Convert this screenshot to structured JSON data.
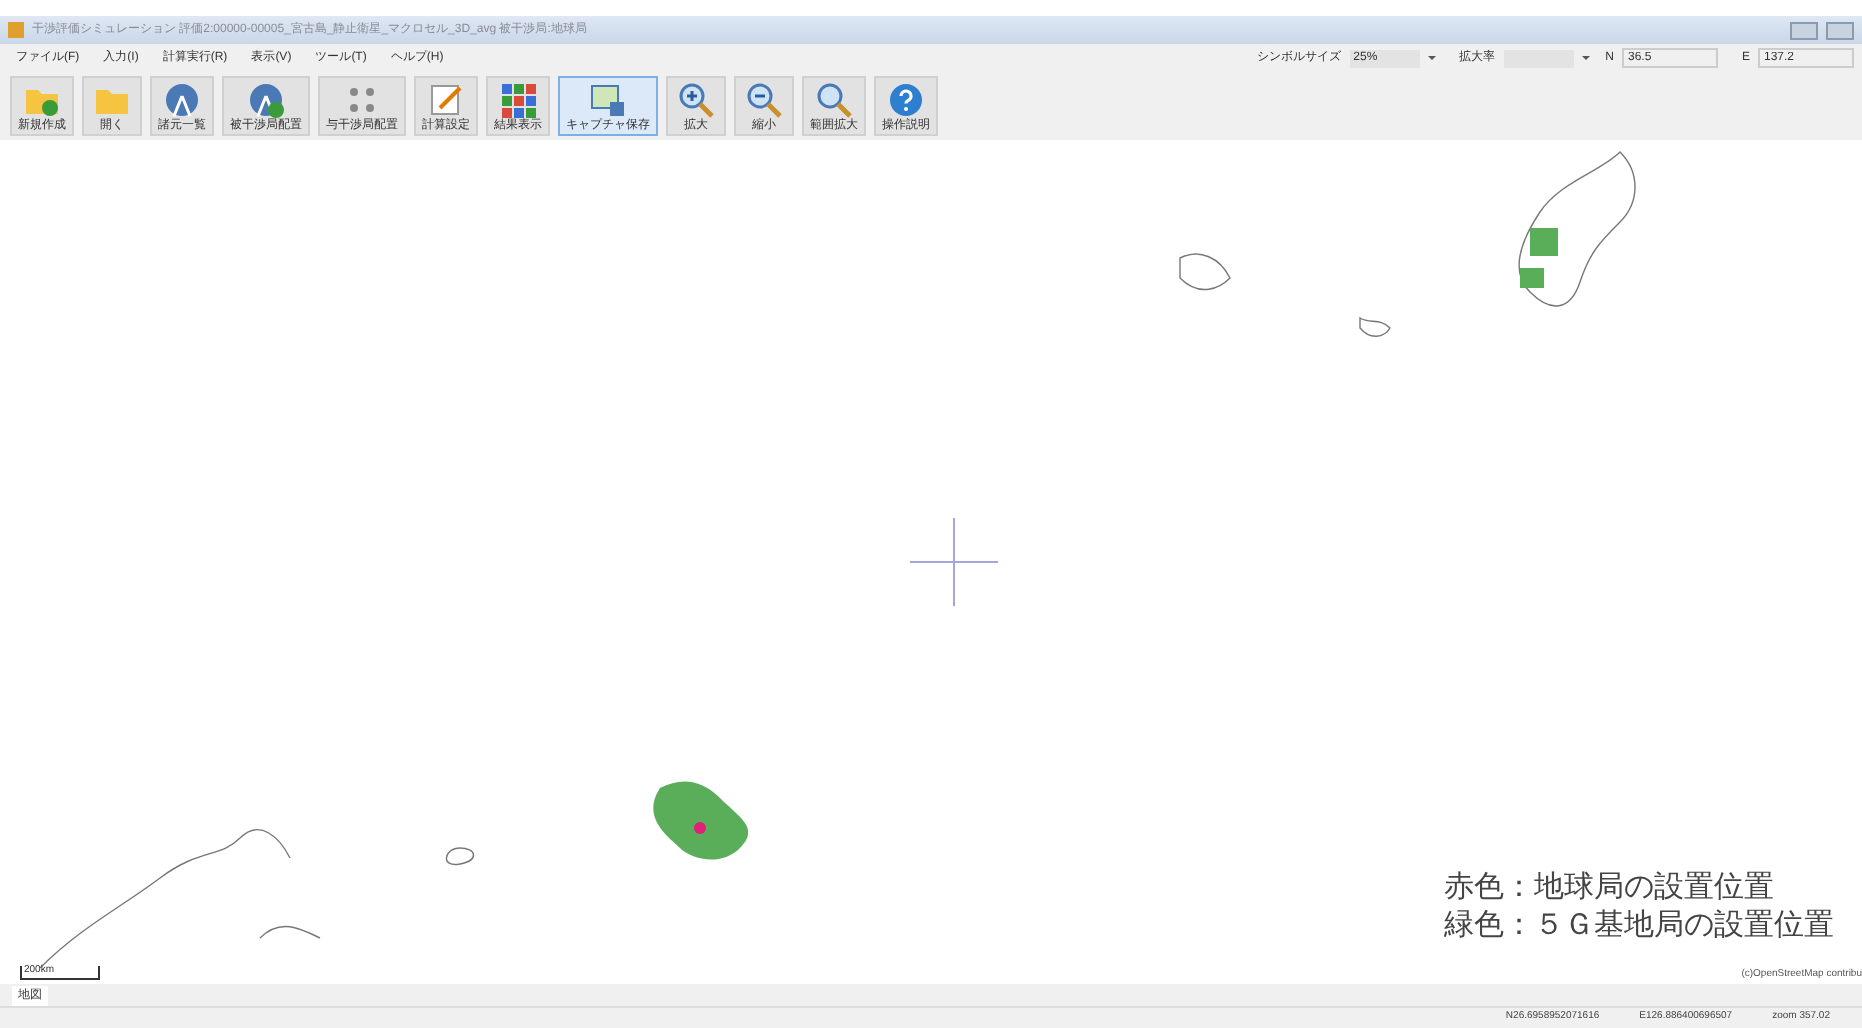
{
  "window": {
    "title": "干渉評価シミュレーション 評価2:00000-00005_宮古島_静止衛星_マクロセル_3D_avg 被干渉局:地球局"
  },
  "menu": [
    "ファイル(F)",
    "入力(I)",
    "計算実行(R)",
    "表示(V)",
    "ツール(T)",
    "ヘルプ(H)"
  ],
  "toolbar": [
    {
      "label": "新規作成",
      "kind": "new",
      "selected": false
    },
    {
      "label": "開く",
      "kind": "open",
      "selected": false
    },
    {
      "label": "諸元一覧",
      "kind": "antenna",
      "selected": false
    },
    {
      "label": "被干渉局配置",
      "kind": "antenna-add",
      "selected": false
    },
    {
      "label": "与干渉局配置",
      "kind": "dots",
      "selected": false
    },
    {
      "label": "計算設定",
      "kind": "edit",
      "selected": false
    },
    {
      "label": "結果表示",
      "kind": "grid",
      "selected": false
    },
    {
      "label": "キャプチャ保存",
      "kind": "capture",
      "selected": true
    },
    {
      "label": "拡大",
      "kind": "zoom-in",
      "selected": false
    },
    {
      "label": "縮小",
      "kind": "zoom-out",
      "selected": false
    },
    {
      "label": "範囲拡大",
      "kind": "zoom-area",
      "selected": false
    },
    {
      "label": "操作説明",
      "kind": "help",
      "selected": false
    }
  ],
  "controls": {
    "symbol_label": "シンボルサイズ",
    "symbol_value": "25%",
    "zoom_label": "拡大率",
    "n_label": "N",
    "n_value": "36.5",
    "e_label": "E",
    "e_value": "137.2"
  },
  "map": {
    "scale": "200km",
    "attribution": "(c)OpenStreetMap contribu",
    "legend": [
      "赤色：地球局の設置位置",
      "緑色：５Ｇ基地局の設置位置"
    ]
  },
  "tabs": [
    {
      "label": "地図",
      "selected": true
    }
  ],
  "status_bar": [
    "N26.6958952071616",
    "E126.886400696507",
    "zoom 357.02"
  ]
}
